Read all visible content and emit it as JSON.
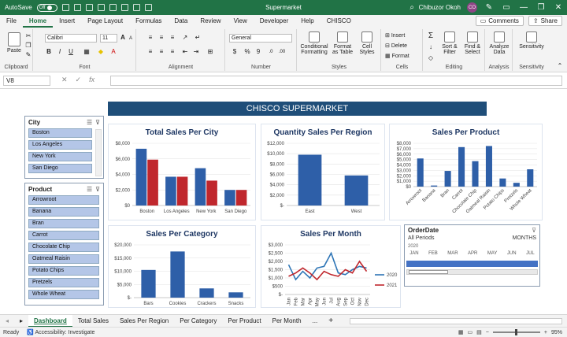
{
  "titlebar": {
    "autosave_label": "AutoSave",
    "autosave_state": "Off",
    "title": "Supermarket",
    "search_glyph": "⌕",
    "user_name": "Chibuzor Okoh",
    "user_initials": "CO",
    "minimize": "—",
    "restore": "❐",
    "close": "✕"
  },
  "tabs": [
    "File",
    "Home",
    "Insert",
    "Page Layout",
    "Formulas",
    "Data",
    "Review",
    "View",
    "Developer",
    "Help",
    "CHISCO"
  ],
  "tabs_right": {
    "comments": "Comments",
    "share": "Share"
  },
  "ribbon": {
    "clipboard": {
      "paste": "Paste",
      "label": "Clipboard"
    },
    "font": {
      "name": "Calibri",
      "size": "11",
      "label": "Font",
      "bold": "B",
      "italic": "I",
      "underline": "U",
      "grow": "A",
      "shrink": "A"
    },
    "alignment": {
      "label": "Alignment"
    },
    "number": {
      "format": "General",
      "label": "Number",
      "dollar": "$",
      "percent": "%",
      "comma": "9"
    },
    "styles": {
      "conditional": "Conditional Formatting",
      "table": "Format as Table",
      "cell": "Cell Styles",
      "label": "Styles"
    },
    "cells": {
      "insert": "Insert",
      "delete": "Delete",
      "format": "Format",
      "label": "Cells"
    },
    "editing": {
      "sum": "Σ",
      "sort": "Sort & Filter",
      "find": "Find & Select",
      "label": "Editing"
    },
    "analysis": {
      "analyze": "Analyze Data",
      "label": "Analysis"
    },
    "sensitivity": {
      "btn": "Sensitivity",
      "label": "Sensitivity"
    }
  },
  "formula_bar": {
    "name_box": "V8",
    "cancel": "✕",
    "enter": "✓",
    "fx": "fx",
    "value": ""
  },
  "dashboard": {
    "banner": "CHISCO SUPERMARKET",
    "city_slicer": {
      "title": "City",
      "items": [
        "Boston",
        "Los Angeles",
        "New York",
        "San Diego"
      ]
    },
    "product_slicer": {
      "title": "Product",
      "items": [
        "Arrowroot",
        "Banana",
        "Bran",
        "Carrot",
        "Chocolate Chip",
        "Oatmeal Raisin",
        "Potato Chips",
        "Pretzels",
        "Whole Wheat"
      ]
    },
    "timeline": {
      "title": "OrderDate",
      "periods": "All Periods",
      "unit": "MONTHS",
      "year": "2020",
      "months": [
        "JAN",
        "FEB",
        "MAR",
        "APR",
        "MAY",
        "JUN",
        "JUL"
      ]
    }
  },
  "chart_data": [
    {
      "type": "bar",
      "title": "Total Sales Per City",
      "categories": [
        "Boston",
        "Los Angeles",
        "New York",
        "San Diego"
      ],
      "series": [
        {
          "values": [
            7300,
            3700,
            4800,
            2000
          ],
          "color": "#2e5fa8"
        },
        {
          "values": [
            5900,
            3700,
            3200,
            2000
          ],
          "color": "#c0272d"
        }
      ],
      "ylim": [
        0,
        8000
      ],
      "yticks": [
        "$0",
        "$2,000",
        "$4,000",
        "$6,000",
        "$8,000"
      ],
      "ytick_values": [
        0,
        2000,
        4000,
        6000,
        8000
      ]
    },
    {
      "type": "bar",
      "title": "Quantity Sales Per Region",
      "categories": [
        "East",
        "West"
      ],
      "series": [
        {
          "values": [
            9800,
            5800
          ],
          "color": "#2e5fa8"
        }
      ],
      "ylim": [
        0,
        12000
      ],
      "yticks": [
        "$-",
        "$2,000",
        "$4,000",
        "$6,000",
        "$8,000",
        "$10,000",
        "$12,000"
      ],
      "ytick_values": [
        0,
        2000,
        4000,
        6000,
        8000,
        10000,
        12000
      ]
    },
    {
      "type": "bar",
      "title": "Sales Per Product",
      "categories": [
        "Arrowroot",
        "Banana",
        "Bran",
        "Carrot",
        "Chocolate Chip",
        "Oatmeal Raisin",
        "Potato Chips",
        "Pretzels",
        "Whole Wheat"
      ],
      "series": [
        {
          "values": [
            5200,
            200,
            2900,
            7300,
            4700,
            7500,
            1500,
            700,
            3200
          ],
          "color": "#2e5fa8"
        }
      ],
      "ylim": [
        0,
        8000
      ],
      "yticks": [
        "$0",
        "$1,000",
        "$2,000",
        "$3,000",
        "$4,000",
        "$5,000",
        "$6,000",
        "$7,000",
        "$8,000"
      ],
      "ytick_values": [
        0,
        1000,
        2000,
        3000,
        4000,
        5000,
        6000,
        7000,
        8000
      ]
    },
    {
      "type": "bar",
      "title": "Sales Per Category",
      "categories": [
        "Bars",
        "Cookies",
        "Crackers",
        "Snacks"
      ],
      "series": [
        {
          "values": [
            10500,
            17500,
            3500,
            2000
          ],
          "color": "#2e5fa8"
        }
      ],
      "ylim": [
        0,
        20000
      ],
      "yticks": [
        "$-",
        "$5,000",
        "$10,000",
        "$15,000",
        "$20,000"
      ],
      "ytick_values": [
        0,
        5000,
        10000,
        15000,
        20000
      ]
    },
    {
      "type": "line",
      "title": "Sales Per Month",
      "categories": [
        "Jan",
        "Feb",
        "Mar",
        "Apr",
        "May",
        "Jun",
        "Jul",
        "Aug",
        "Sep",
        "Oct",
        "Nov",
        "Dec"
      ],
      "series": [
        {
          "name": "2020",
          "values": [
            1800,
            900,
            1400,
            1000,
            1600,
            1700,
            2500,
            1300,
            1200,
            1500,
            1700,
            1600
          ],
          "color": "#2e75b6"
        },
        {
          "name": "2021",
          "values": [
            1100,
            1300,
            1600,
            1300,
            900,
            1400,
            1200,
            1100,
            1500,
            1300,
            2000,
            1400
          ],
          "color": "#c0272d"
        }
      ],
      "ylim": [
        0,
        3000
      ],
      "yticks": [
        "$-",
        "$500",
        "$1,000",
        "$1,500",
        "$2,000",
        "$2,500",
        "$3,000"
      ],
      "ytick_values": [
        0,
        500,
        1000,
        1500,
        2000,
        2500,
        3000
      ]
    }
  ],
  "sheet_tabs": [
    "Dashboard",
    "Total Sales",
    "Sales Per Region",
    "Per Category",
    "Per Product",
    "Per Month",
    "..."
  ],
  "sheet_nav": {
    "prev": "◂",
    "next": "▸",
    "add": "+"
  },
  "status": {
    "ready": "Ready",
    "accessibility": "Accessibility: Investigate",
    "zoom": "95%",
    "zoom_minus": "−",
    "zoom_plus": "+"
  }
}
